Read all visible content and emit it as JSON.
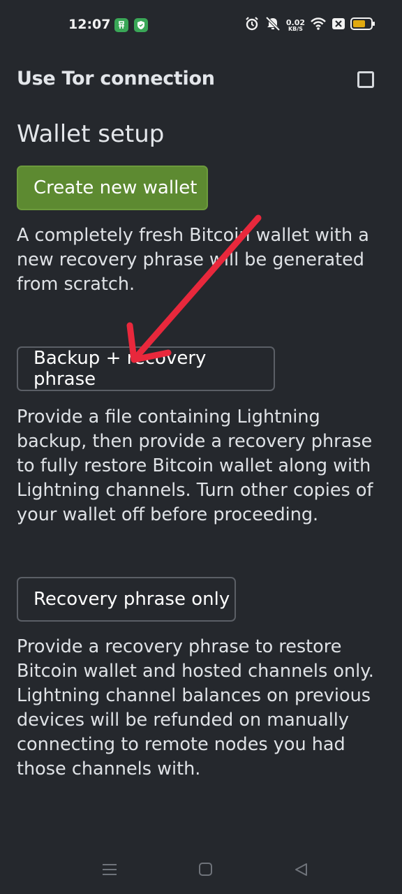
{
  "status_bar": {
    "time": "12:07",
    "net_speed_value": "0.02",
    "net_speed_unit": "KB/S",
    "icons": [
      "app-notification-icon",
      "shield-notification-icon",
      "alarm-icon",
      "mute-icon",
      "wifi-icon",
      "sim-off-icon",
      "battery-icon"
    ],
    "battery_color": "#e0a90f"
  },
  "settings": {
    "tor_label": "Use Tor connection",
    "tor_checked": false
  },
  "wallet_setup": {
    "title": "Wallet setup",
    "create": {
      "label": "Create new wallet",
      "description": "A completely fresh Bitcoin wallet with a new recovery phrase will be generated from scratch.",
      "accent": "#5d8a31"
    },
    "backup": {
      "label": "Backup + recovery phrase",
      "description": "Provide a file containing Lightning backup, then provide a recovery phrase to fully restore Bitcoin wallet along with Lightning channels. Turn other copies of your wallet off before proceeding."
    },
    "recovery": {
      "label": "Recovery phrase only",
      "description": "Provide a recovery phrase to restore Bitcoin wallet and hosted channels only. Lightning channel balances on previous devices will be refunded on manually connecting to remote nodes you had those channels with."
    }
  },
  "annotation": {
    "arrow_color": "#e8283c"
  },
  "nav_bar": {
    "icons": [
      "menu-icon",
      "home-square-icon",
      "back-triangle-icon"
    ]
  }
}
